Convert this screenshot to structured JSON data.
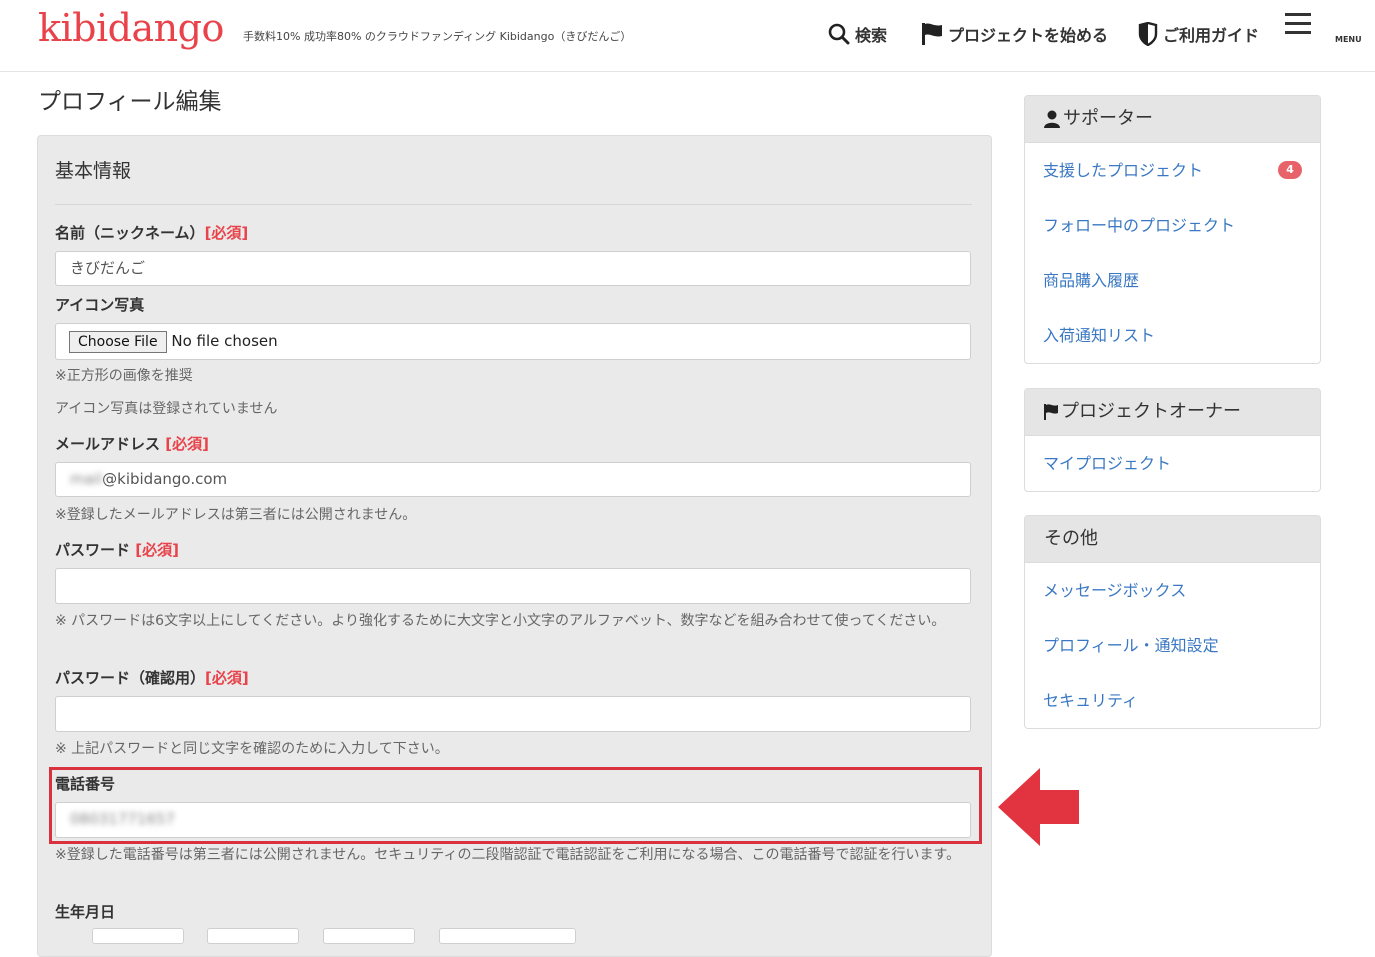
{
  "header": {
    "logo": "kibidango",
    "tagline": "手数料10% 成功率80% のクラウドファンディング Kibidango（きびだんご）",
    "nav": {
      "search": "検索",
      "start_project": "プロジェクトを始める",
      "guide": "ご利用ガイド",
      "menu": "MENU"
    }
  },
  "page": {
    "title": "プロフィール編集"
  },
  "form": {
    "section_title": "基本情報",
    "required_tag": "[必須]",
    "name": {
      "label": "名前（ニックネーム）",
      "value": "きびだんご"
    },
    "icon": {
      "label": "アイコン写真",
      "button": "Choose File",
      "status": "No file chosen",
      "help1": "※正方形の画像を推奨",
      "help2": "アイコン写真は登録されていません"
    },
    "email": {
      "label": "メールアドレス",
      "value_hidden": "mail",
      "value_domain": "@kibidango.com",
      "help": "※登録したメールアドレスは第三者には公開されません。"
    },
    "password": {
      "label": "パスワード",
      "value": "",
      "help": "※ パスワードは6文字以上にしてください。より強化するために大文字と小文字のアルファベット、数字などを組み合わせて使ってください。"
    },
    "password_confirm": {
      "label": "パスワード（確認用）",
      "value": "",
      "help": "※ 上記パスワードと同じ文字を確認のために入力して下さい。"
    },
    "phone": {
      "label": "電話番号",
      "value": "08031771657",
      "help": "※登録した電話番号は第三者には公開されません。セキュリティの二段階認証で電話認証をご利用になる場合、この電話番号で認証を行います。"
    },
    "birthday": {
      "label": "生年月日"
    }
  },
  "sidebar": {
    "supporter": {
      "title": "サポーター",
      "items": [
        {
          "label": "支援したプロジェクト",
          "badge": "4"
        },
        {
          "label": "フォロー中のプロジェクト"
        },
        {
          "label": "商品購入履歴"
        },
        {
          "label": "入荷通知リスト"
        }
      ]
    },
    "owner": {
      "title": "プロジェクトオーナー",
      "items": [
        {
          "label": "マイプロジェクト"
        }
      ]
    },
    "other": {
      "title": "その他",
      "items": [
        {
          "label": "メッセージボックス"
        },
        {
          "label": "プロフィール・通知設定"
        },
        {
          "label": "セキュリティ"
        }
      ]
    }
  },
  "colors": {
    "brand": "#e8424a",
    "link": "#3a78c3",
    "highlight": "#d9313d"
  }
}
